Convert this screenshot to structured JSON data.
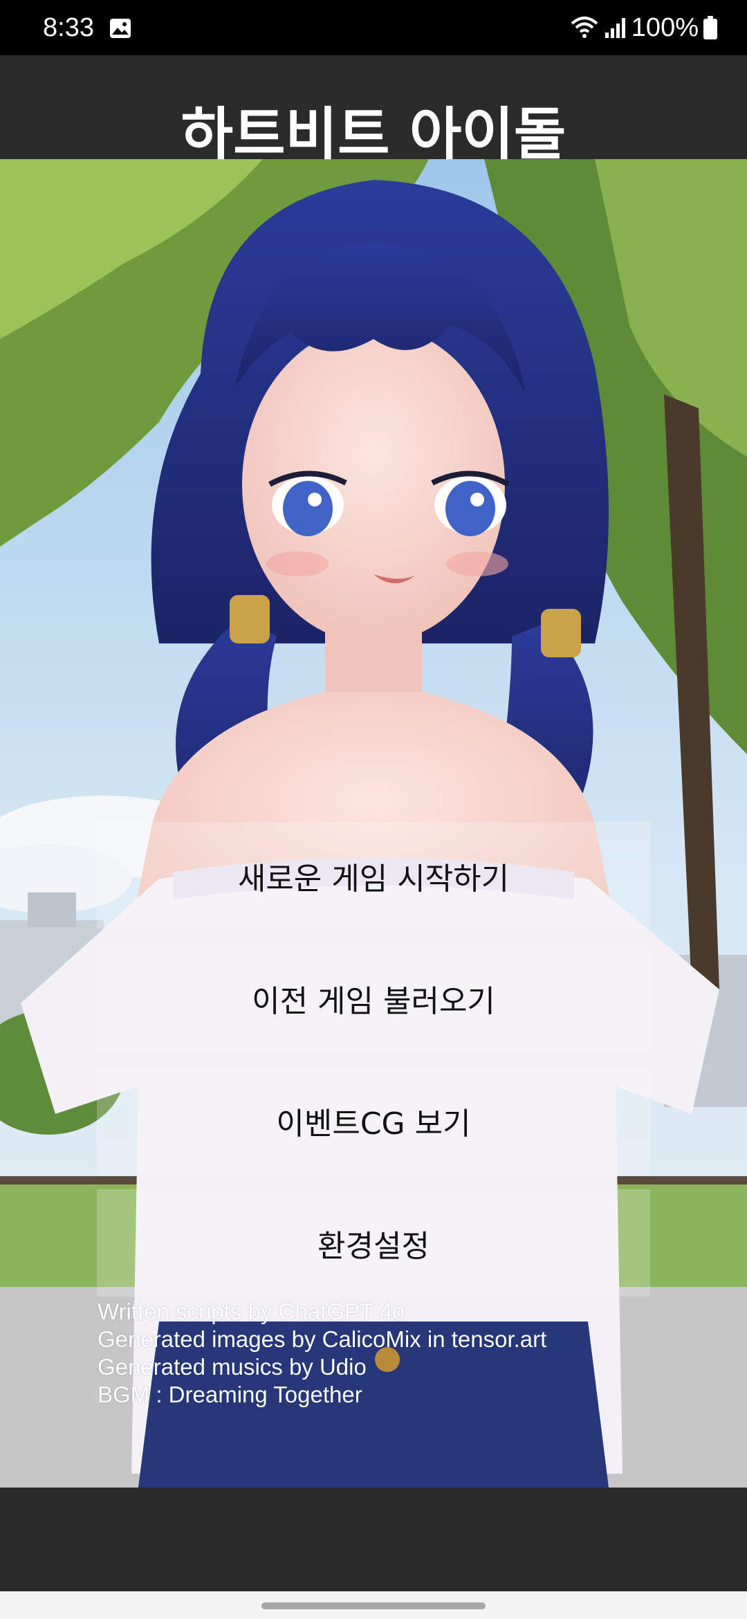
{
  "status_bar": {
    "time": "8:33",
    "battery": "100%",
    "icons": [
      "gallery-icon",
      "wifi-icon",
      "signal-icon",
      "battery-icon"
    ]
  },
  "app": {
    "title": "하트비트 아이돌"
  },
  "menu": {
    "items": [
      "새로운 게임 시작하기",
      "이전 게임 불러오기",
      "이벤트CG 보기",
      "환경설정"
    ]
  },
  "credits": [
    "Written scripts by ChatGPT 4o",
    "Generated images by CalicoMix in tensor.art",
    "Generated musics by Udio",
    "BGM : Dreaming Together"
  ]
}
